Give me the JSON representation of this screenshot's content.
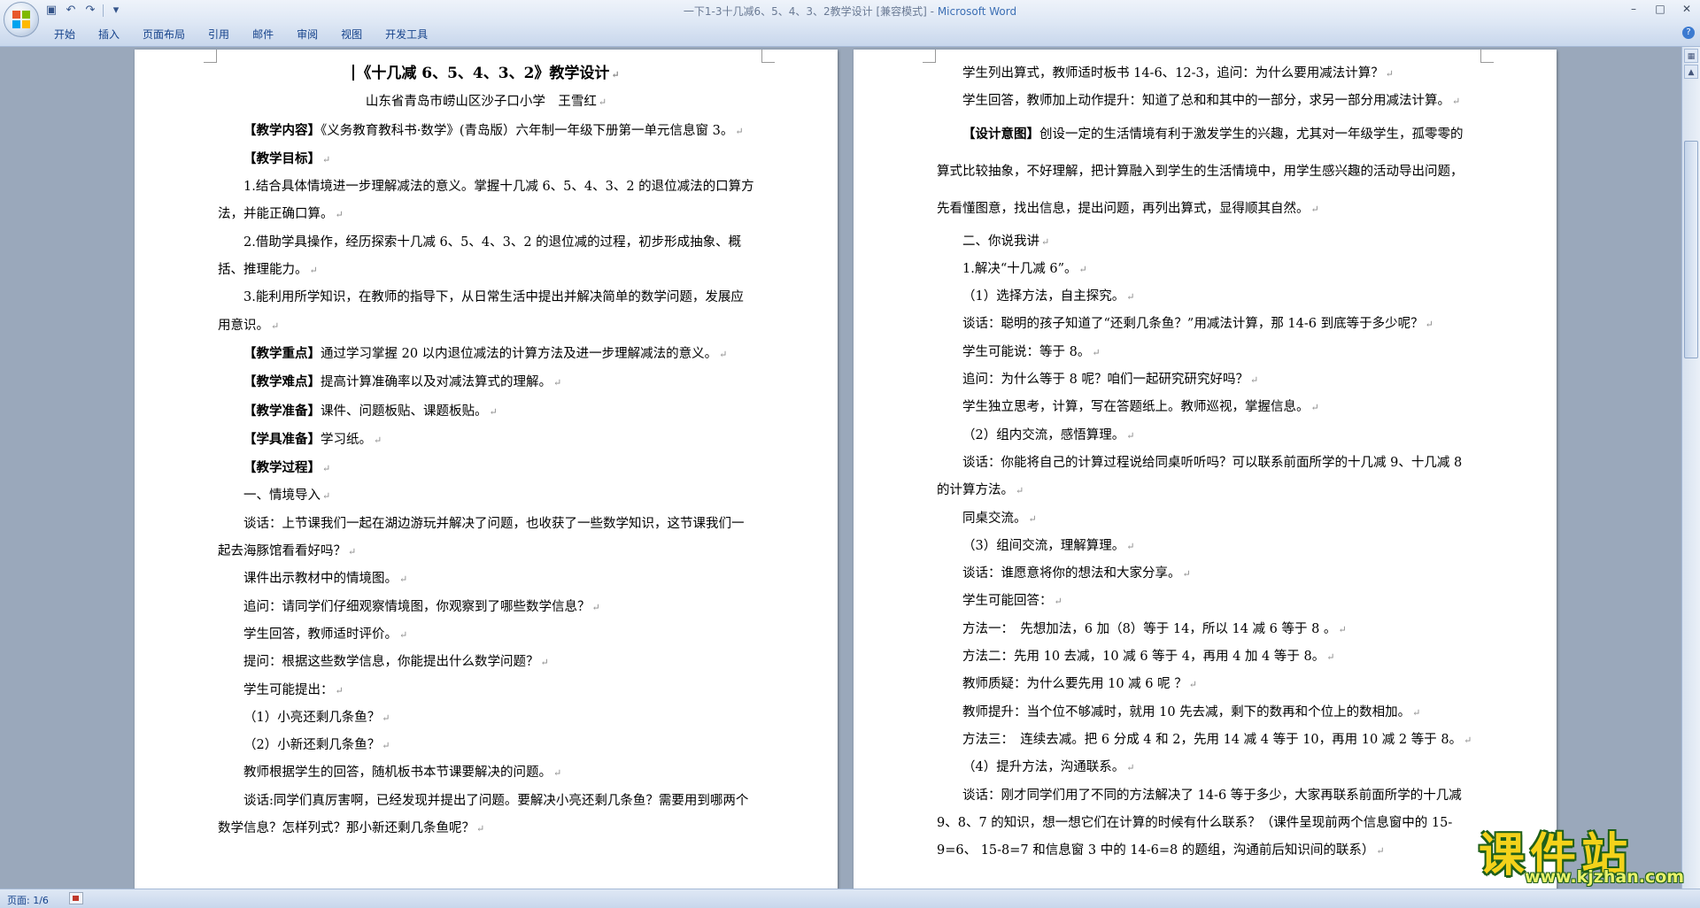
{
  "window": {
    "title": "一下1-3十几减6、5、4、3、2教学设计 [兼容模式] - ",
    "app_name": "Microsoft Word",
    "controls": [
      "–",
      "□",
      "✕"
    ]
  },
  "quick_access": {
    "save_icon": "save-icon",
    "undo_icon": "undo-icon",
    "redo_icon": "redo-icon",
    "customize_icon": "chevron-down-icon"
  },
  "ribbon": {
    "tabs": [
      "开始",
      "插入",
      "页面布局",
      "引用",
      "邮件",
      "审阅",
      "视图",
      "开发工具"
    ]
  },
  "status_bar": {
    "page": "页面: 1/6"
  },
  "colors": {
    "workspace": "#9aa8bb",
    "ribbon": "#dfe8f5",
    "tab_text": "#15428b",
    "watermark_fill": "#f4d21a",
    "watermark_outline": "#1f5f1a"
  },
  "watermark": {
    "text": "课件站",
    "url": "www.kjzhan.com"
  },
  "left_page": [
    {
      "cls": "title",
      "text": "《十几减 6、5、4、3、2》教学设计"
    },
    {
      "cls": "center",
      "text": "山东省青岛市崂山区沙子口小学　王雪红"
    },
    {
      "bold": "【教学内容】",
      "text": "《义务教育教科书·数学》(青岛版）六年制一年级下册第一单元信息窗 3。"
    },
    {
      "bold": "【教学目标】",
      "text": ""
    },
    {
      "text": "1.结合具体情境进一步理解减法的意义。掌握十几减 6、5、4、3、2 的退位减法的口算方法，并能正确口算。"
    },
    {
      "text": "2.借助学具操作，经历探索十几减 6、5、4、3、2 的退位减的过程，初步形成抽象、概括、推理能力。"
    },
    {
      "text": "3.能利用所学知识，在教师的指导下，从日常生活中提出并解决简单的数学问题，发展应用意识。"
    },
    {
      "bold": "【教学重点】",
      "text": "通过学习掌握 20 以内退位减法的计算方法及进一步理解减法的意义。"
    },
    {
      "bold": "【教学难点】",
      "text": "提高计算准确率以及对减法算式的理解。"
    },
    {
      "bold": "【教学准备】",
      "text": "课件、问题板贴、课题板贴。"
    },
    {
      "bold": "【学具准备】",
      "text": "学习纸。"
    },
    {
      "bold": "【教学过程】",
      "text": ""
    },
    {
      "text": "一、情境导入"
    },
    {
      "text": "谈话：上节课我们一起在湖边游玩并解决了问题，也收获了一些数学知识，这节课我们一起去海豚馆看看好吗？"
    },
    {
      "text": "课件出示教材中的情境图。"
    },
    {
      "text": "追问：请同学们仔细观察情境图，你观察到了哪些数学信息？"
    },
    {
      "text": "学生回答，教师适时评价。"
    },
    {
      "text": "提问：根据这些数学信息，你能提出什么数学问题？"
    },
    {
      "text": "学生可能提出："
    },
    {
      "text": "（1）小亮还剩几条鱼？"
    },
    {
      "text": "（2）小新还剩几条鱼？"
    },
    {
      "text": "教师根据学生的回答，随机板书本节课要解决的问题。"
    },
    {
      "text": "谈话:同学们真厉害啊，已经发现并提出了问题。要解决小亮还剩几条鱼？需要用到哪两个数学信息？怎样列式？那小新还剩几条鱼呢？"
    }
  ],
  "right_page": [
    {
      "text": "学生列出算式，教师适时板书 14-6、12-3，追问：为什么要用减法计算？"
    },
    {
      "text": "学生回答，教师加上动作提升：知道了总和和其中的一部分，求另一部分用减法计算。"
    },
    {
      "cls": "loose",
      "bold": "【设计意图】",
      "text": "创设一定的生活情境有利于激发学生的兴趣，尤其对一年级学生，孤零零的算式比较抽象，不好理解，把计算融入到学生的生活情境中，用学生感兴趣的活动导出问题，先看懂图意，找出信息，提出问题，再列出算式，显得顺其自然。"
    },
    {
      "text": "二、你说我讲"
    },
    {
      "text": "1.解决“十几减 6”。"
    },
    {
      "text": "（1）选择方法，自主探究。"
    },
    {
      "text": "谈话：聪明的孩子知道了“还剩几条鱼？”用减法计算，那 14-6 到底等于多少呢？"
    },
    {
      "text": "学生可能说：等于 8。"
    },
    {
      "text": "追问：为什么等于 8 呢？咱们一起研究研究好吗？"
    },
    {
      "text": "学生独立思考，计算，写在答题纸上。教师巡视，掌握信息。"
    },
    {
      "text": "（2）组内交流，感悟算理。"
    },
    {
      "text": "谈话：你能将自己的计算过程说给同桌听听吗？可以联系前面所学的十几减 9、十几减 8 的计算方法。"
    },
    {
      "text": "同桌交流。"
    },
    {
      "text": "（3）组间交流，理解算理。"
    },
    {
      "text": "谈话：谁愿意将你的想法和大家分享。"
    },
    {
      "text": "学生可能回答："
    },
    {
      "text": "方法一：　先想加法，6 加（8）等于 14，所以 14 减 6 等于 8 。"
    },
    {
      "text": "方法二：先用 10 去减，10 减 6 等于 4，再用 4 加 4 等于 8。"
    },
    {
      "text": "教师质疑：为什么要先用 10 减 6 呢 ？"
    },
    {
      "text": "教师提升：当个位不够减时，就用 10 先去减，剩下的数再和个位上的数相加。"
    },
    {
      "text": "方法三：　连续去减。把 6 分成 4 和 2，先用 14 减 4 等于 10，再用 10 减 2 等于 8。"
    },
    {
      "text": "（4）提升方法，沟通联系。"
    },
    {
      "text": "谈话：刚才同学们用了不同的方法解决了 14-6 等于多少，大家再联系前面所学的十几减 9、8、7 的知识，想一想它们在计算的时候有什么联系？（课件呈现前两个信息窗中的 15-9=6、 15-8=7 和信息窗 3 中的 14-6=8 的题组，沟通前后知识间的联系）"
    }
  ]
}
